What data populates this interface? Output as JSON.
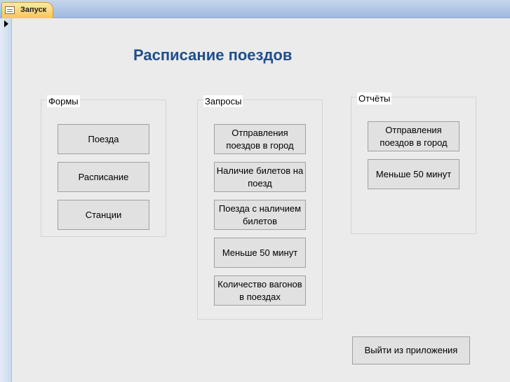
{
  "tab": {
    "label": "Запуск",
    "icon": "form-icon"
  },
  "title": "Расписание поездов",
  "groups": {
    "forms": {
      "label": "Формы",
      "buttons": [
        "Поезда",
        "Расписание",
        "Станции"
      ]
    },
    "queries": {
      "label": "Запросы",
      "buttons": [
        "Отправления поездов в город",
        "Наличие билетов на поезд",
        "Поезда с наличием билетов",
        "Меньше 50 минут",
        "Количество вагонов в поездах"
      ]
    },
    "reports": {
      "label": "Отчёты",
      "buttons": [
        "Отправления поездов в город",
        "Меньше 50 минут"
      ]
    }
  },
  "exit_button": "Выйти из приложения",
  "colors": {
    "title": "#1f4e8c",
    "background": "#ebebeb",
    "tab_active": "#f6c659",
    "button_face": "#e1e1e1"
  }
}
